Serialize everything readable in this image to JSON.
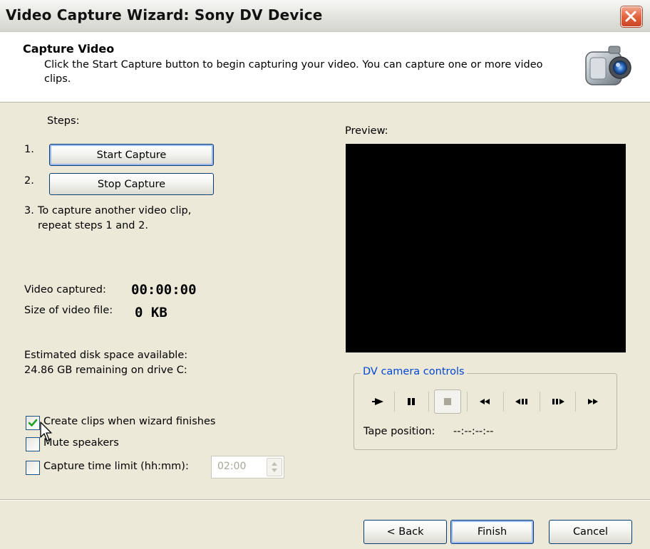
{
  "window": {
    "title": "Video Capture Wizard: Sony DV Device"
  },
  "header": {
    "title": "Capture Video",
    "description": "Click the Start Capture button to begin capturing your video. You can capture one or more video clips."
  },
  "steps": {
    "label": "Steps:",
    "step1_num": "1.",
    "step1_button": "Start Capture",
    "step2_num": "2.",
    "step2_button": "Stop Capture",
    "step3_num": "3.",
    "step3_text_line1": "To capture another video clip,",
    "step3_text_line2": "repeat steps 1 and 2."
  },
  "stats": {
    "video_captured_label": "Video captured:",
    "video_captured_value": "00:00:00",
    "file_size_label": "Size of video file:",
    "file_size_value": "0 KB",
    "disk_label": "Estimated disk space available:",
    "disk_value": "24.86 GB remaining on drive C:"
  },
  "options": {
    "create_clips_label": "Create clips when wizard finishes",
    "create_clips_checked": true,
    "mute_label": "Mute speakers",
    "mute_checked": false,
    "time_limit_label": "Capture time limit (hh:mm):",
    "time_limit_checked": false,
    "time_limit_value": "02:00"
  },
  "preview": {
    "label": "Preview:"
  },
  "dv_controls": {
    "group_label": "DV camera controls",
    "buttons": [
      "play-icon",
      "pause-icon",
      "stop-icon",
      "rewind-icon",
      "step-back-icon",
      "step-forward-icon",
      "fast-forward-icon"
    ],
    "tape_position_label": "Tape position:",
    "tape_position_value": "--:--:--:--"
  },
  "footer": {
    "back_label": "< Back",
    "finish_label": "Finish",
    "cancel_label": "Cancel"
  },
  "colors": {
    "group_label": "#0046d5",
    "dialog_bg": "#ece9d8",
    "preview_bg": "#000000"
  }
}
